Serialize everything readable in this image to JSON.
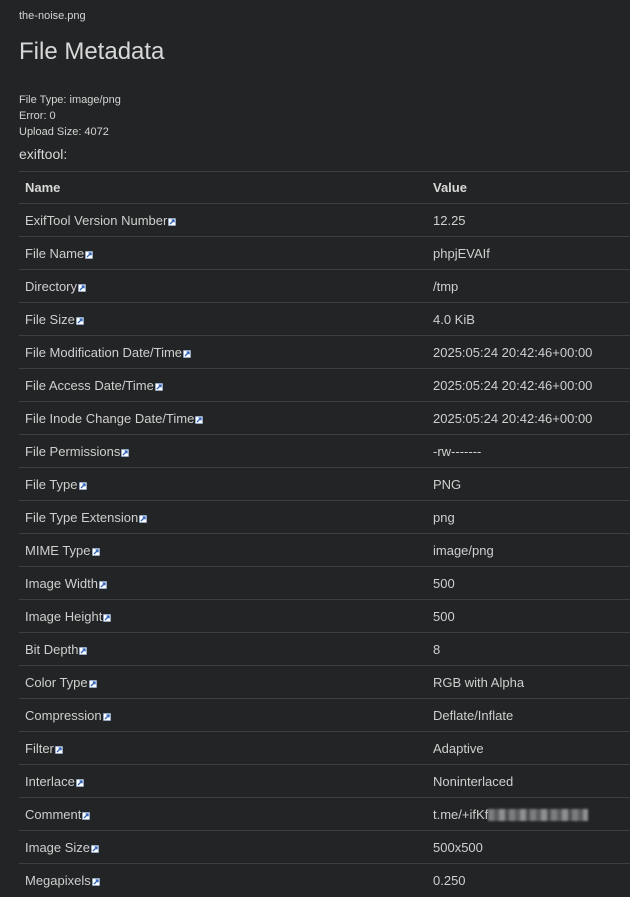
{
  "file": {
    "name": "the-noise.png"
  },
  "page": {
    "title": "File Metadata"
  },
  "upload": {
    "file_type": "File Type: image/png",
    "error": "Error: 0",
    "upload_size": "Upload Size: 4072"
  },
  "section": {
    "label": "exiftool:"
  },
  "table": {
    "headers": {
      "name": "Name",
      "value": "Value"
    },
    "rows": [
      {
        "name": "ExifTool Version Number",
        "value": "12.25"
      },
      {
        "name": "File Name",
        "value": "phpjEVAIf"
      },
      {
        "name": "Directory",
        "value": "/tmp"
      },
      {
        "name": "File Size",
        "value": "4.0 KiB"
      },
      {
        "name": "File Modification Date/Time",
        "value": "2025:05:24 20:42:46+00:00"
      },
      {
        "name": "File Access Date/Time",
        "value": "2025:05:24 20:42:46+00:00"
      },
      {
        "name": "File Inode Change Date/Time",
        "value": "2025:05:24 20:42:46+00:00"
      },
      {
        "name": "File Permissions",
        "value": "-rw-------"
      },
      {
        "name": "File Type",
        "value": "PNG"
      },
      {
        "name": "File Type Extension",
        "value": "png"
      },
      {
        "name": "MIME Type",
        "value": "image/png"
      },
      {
        "name": "Image Width",
        "value": "500"
      },
      {
        "name": "Image Height",
        "value": "500"
      },
      {
        "name": "Bit Depth",
        "value": "8"
      },
      {
        "name": "Color Type",
        "value": "RGB with Alpha"
      },
      {
        "name": "Compression",
        "value": "Deflate/Inflate"
      },
      {
        "name": "Filter",
        "value": "Adaptive"
      },
      {
        "name": "Interlace",
        "value": "Noninterlaced"
      },
      {
        "name": "Comment",
        "value": "t.me/+ifKf",
        "blurred": true
      },
      {
        "name": "Image Size",
        "value": "500x500"
      },
      {
        "name": "Megapixels",
        "value": "0.250"
      }
    ]
  },
  "icons": {
    "external_link": "external-link-icon"
  },
  "colors": {
    "background": "#232425",
    "text": "#d4d4d4",
    "border": "#3d3e40",
    "link_icon": "#7aa7e0"
  }
}
